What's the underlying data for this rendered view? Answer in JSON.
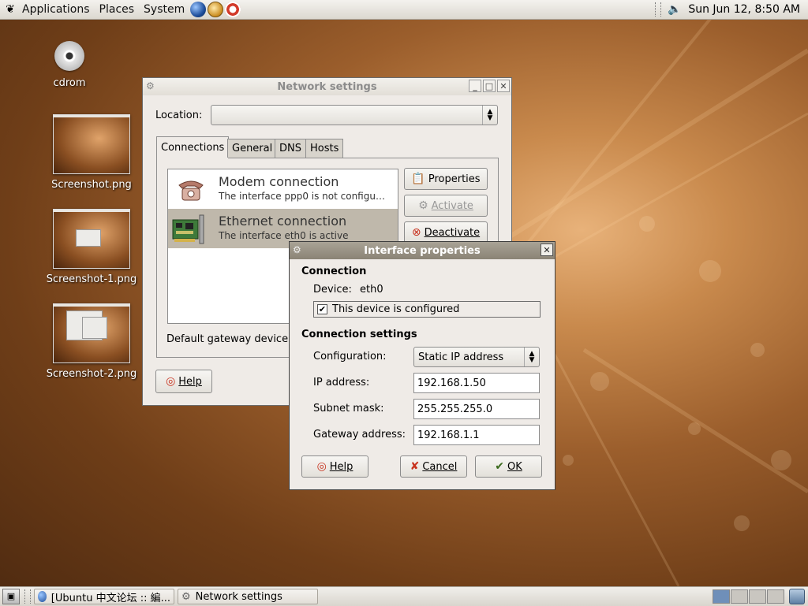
{
  "top_panel": {
    "menus": [
      "Applications",
      "Places",
      "System"
    ],
    "clock": "Sun Jun 12,  8:50 AM"
  },
  "desktop": {
    "icons": [
      "cdrom",
      "Screenshot.png",
      "Screenshot-1.png",
      "Screenshot-2.png"
    ]
  },
  "network_window": {
    "title": "Network settings",
    "location_label": "Location:",
    "location_value": "",
    "tabs": [
      "Connections",
      "General",
      "DNS",
      "Hosts"
    ],
    "connections": [
      {
        "title": "Modem connection",
        "desc": "The interface ppp0 is not configu…"
      },
      {
        "title": "Ethernet connection",
        "desc": "The interface eth0 is active"
      }
    ],
    "buttons": {
      "properties": "Properties",
      "activate": "Activate",
      "deactivate": "Deactivate",
      "help": "Help"
    },
    "gateway_label": "Default gateway device:"
  },
  "iface_dialog": {
    "title": "Interface properties",
    "section_connection": "Connection",
    "device_label": "Device:",
    "device_value": "eth0",
    "configured_label": "This device is configured",
    "section_settings": "Connection settings",
    "config_label": "Configuration:",
    "config_value": "Static IP address",
    "ip_label": "IP address:",
    "ip_value": "192.168.1.50",
    "mask_label": "Subnet mask:",
    "mask_value": "255.255.255.0",
    "gateway_label": "Gateway address:",
    "gateway_value": "192.168.1.1",
    "help": "Help",
    "cancel": "Cancel",
    "ok": "OK"
  },
  "bottom_panel": {
    "tasks": [
      "[Ubuntu 中文论坛 :: 編...",
      "Network settings"
    ]
  }
}
